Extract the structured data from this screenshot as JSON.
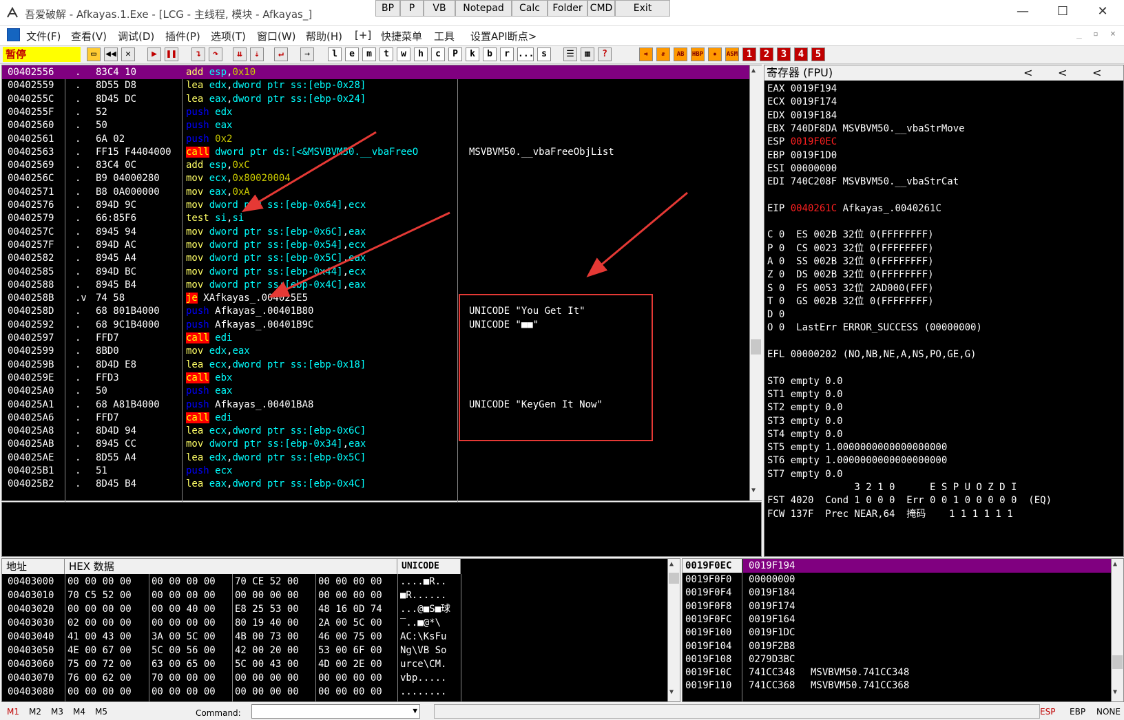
{
  "window": {
    "title": "吾爱破解 - Afkayas.1.Exe - [LCG - 主线程, 模块 - Afkayas_]",
    "top_buttons": [
      "BP",
      "P",
      "VB",
      "Notepad",
      "Calc",
      "Folder",
      "CMD",
      "Exit"
    ],
    "controls": [
      "—",
      "☐",
      "✕"
    ]
  },
  "menu": [
    "文件(F)",
    "查看(V)",
    "调试(D)",
    "插件(P)",
    "选项(T)",
    "窗口(W)",
    "帮助(H)",
    "[+]",
    "快捷菜单",
    "工具",
    "设置API断点>"
  ],
  "toolbar": {
    "status": "暂停",
    "letters": [
      "l",
      "e",
      "m",
      "t",
      "w",
      "h",
      "c",
      "P",
      "k",
      "b",
      "r",
      "...",
      "s"
    ],
    "numbers": [
      "1",
      "2",
      "3",
      "4",
      "5"
    ]
  },
  "cpu": {
    "rows": [
      {
        "addr": "00402556",
        "mark": ".",
        "hex": "83C4 10",
        "asm": [
          [
            "mn",
            "add "
          ],
          [
            "reg",
            "esp"
          ],
          [
            "txt",
            ","
          ],
          [
            "imm",
            "0x10"
          ]
        ],
        "comment": "",
        "selected": true
      },
      {
        "addr": "00402559",
        "mark": ".",
        "hex": "8D55 D8",
        "asm": [
          [
            "mn",
            "lea "
          ],
          [
            "reg",
            "edx"
          ],
          [
            "txt",
            ","
          ],
          [
            "reg",
            "dword ptr ss:[ebp-0x28]"
          ]
        ],
        "comment": ""
      },
      {
        "addr": "0040255C",
        "mark": ".",
        "hex": "8D45 DC",
        "asm": [
          [
            "mn",
            "lea "
          ],
          [
            "reg",
            "eax"
          ],
          [
            "txt",
            ","
          ],
          [
            "reg",
            "dword ptr ss:[ebp-0x24]"
          ]
        ],
        "comment": ""
      },
      {
        "addr": "0040255F",
        "mark": ".",
        "hex": "52",
        "asm": [
          [
            "push",
            "push "
          ],
          [
            "reg",
            "edx"
          ]
        ],
        "comment": ""
      },
      {
        "addr": "00402560",
        "mark": ".",
        "hex": "50",
        "asm": [
          [
            "push",
            "push "
          ],
          [
            "reg",
            "eax"
          ]
        ],
        "comment": ""
      },
      {
        "addr": "00402561",
        "mark": ".",
        "hex": "6A 02",
        "asm": [
          [
            "push",
            "push "
          ],
          [
            "imm",
            "0x2"
          ]
        ],
        "comment": ""
      },
      {
        "addr": "00402563",
        "mark": ".",
        "hex": "FF15 F4404000",
        "asm": [
          [
            "call",
            "call"
          ],
          [
            "txt",
            " "
          ],
          [
            "reg",
            "dword ptr ds:[<&MSVBVM50.__vbaFreeO"
          ]
        ],
        "comment": "MSVBVM50.__vbaFreeObjList"
      },
      {
        "addr": "00402569",
        "mark": ".",
        "hex": "83C4 0C",
        "asm": [
          [
            "mn",
            "add "
          ],
          [
            "reg",
            "esp"
          ],
          [
            "txt",
            ","
          ],
          [
            "imm",
            "0xC"
          ]
        ],
        "comment": ""
      },
      {
        "addr": "0040256C",
        "mark": ".",
        "hex": "B9 04000280",
        "asm": [
          [
            "mn",
            "mov "
          ],
          [
            "reg",
            "ecx"
          ],
          [
            "txt",
            ","
          ],
          [
            "imm",
            "0x80020004"
          ]
        ],
        "comment": ""
      },
      {
        "addr": "00402571",
        "mark": ".",
        "hex": "B8 0A000000",
        "asm": [
          [
            "mn",
            "mov "
          ],
          [
            "reg",
            "eax"
          ],
          [
            "txt",
            ","
          ],
          [
            "imm",
            "0xA"
          ]
        ],
        "comment": ""
      },
      {
        "addr": "00402576",
        "mark": ".",
        "hex": "894D 9C",
        "asm": [
          [
            "mn",
            "mov "
          ],
          [
            "reg",
            "dword ptr ss:[ebp-0x64]"
          ],
          [
            "txt",
            ","
          ],
          [
            "reg",
            "ecx"
          ]
        ],
        "comment": ""
      },
      {
        "addr": "00402579",
        "mark": ".",
        "hex": "66:85F6",
        "asm": [
          [
            "mn",
            "test "
          ],
          [
            "reg",
            "si"
          ],
          [
            "txt",
            ","
          ],
          [
            "reg",
            "si"
          ]
        ],
        "comment": ""
      },
      {
        "addr": "0040257C",
        "mark": ".",
        "hex": "8945 94",
        "asm": [
          [
            "mn",
            "mov "
          ],
          [
            "reg",
            "dword ptr ss:[ebp-0x6C]"
          ],
          [
            "txt",
            ","
          ],
          [
            "reg",
            "eax"
          ]
        ],
        "comment": ""
      },
      {
        "addr": "0040257F",
        "mark": ".",
        "hex": "894D AC",
        "asm": [
          [
            "mn",
            "mov "
          ],
          [
            "reg",
            "dword ptr ss:[ebp-0x54]"
          ],
          [
            "txt",
            ","
          ],
          [
            "reg",
            "ecx"
          ]
        ],
        "comment": ""
      },
      {
        "addr": "00402582",
        "mark": ".",
        "hex": "8945 A4",
        "asm": [
          [
            "mn",
            "mov "
          ],
          [
            "reg",
            "dword ptr ss:[ebp-0x5C]"
          ],
          [
            "txt",
            ","
          ],
          [
            "reg",
            "eax"
          ]
        ],
        "comment": ""
      },
      {
        "addr": "00402585",
        "mark": ".",
        "hex": "894D BC",
        "asm": [
          [
            "mn",
            "mov "
          ],
          [
            "reg",
            "dword ptr ss:[ebp-0x44]"
          ],
          [
            "txt",
            ","
          ],
          [
            "reg",
            "ecx"
          ]
        ],
        "comment": ""
      },
      {
        "addr": "00402588",
        "mark": ".",
        "hex": "8945 B4",
        "asm": [
          [
            "mn",
            "mov "
          ],
          [
            "reg",
            "dword ptr ss:[ebp-0x4C]"
          ],
          [
            "txt",
            ","
          ],
          [
            "reg",
            "eax"
          ]
        ],
        "comment": ""
      },
      {
        "addr": "0040258B",
        "mark": ".v",
        "hex": "74 58",
        "asm": [
          [
            "je",
            "je"
          ],
          [
            "txt",
            " XAfkayas_.004025E5"
          ]
        ],
        "comment": ""
      },
      {
        "addr": "0040258D",
        "mark": ".",
        "hex": "68 801B4000",
        "asm": [
          [
            "push",
            "push "
          ],
          [
            "txt",
            "Afkayas_.00401B80"
          ]
        ],
        "comment": "UNICODE \"You Get It\""
      },
      {
        "addr": "00402592",
        "mark": ".",
        "hex": "68 9C1B4000",
        "asm": [
          [
            "push",
            "push "
          ],
          [
            "txt",
            "Afkayas_.00401B9C"
          ]
        ],
        "comment": "UNICODE \"■■\""
      },
      {
        "addr": "00402597",
        "mark": ".",
        "hex": "FFD7",
        "asm": [
          [
            "call",
            "call"
          ],
          [
            "txt",
            " "
          ],
          [
            "reg",
            "edi"
          ]
        ],
        "comment": ""
      },
      {
        "addr": "00402599",
        "mark": ".",
        "hex": "8BD0",
        "asm": [
          [
            "mn",
            "mov "
          ],
          [
            "reg",
            "edx"
          ],
          [
            "txt",
            ","
          ],
          [
            "reg",
            "eax"
          ]
        ],
        "comment": ""
      },
      {
        "addr": "0040259B",
        "mark": ".",
        "hex": "8D4D E8",
        "asm": [
          [
            "mn",
            "lea "
          ],
          [
            "reg",
            "ecx"
          ],
          [
            "txt",
            ","
          ],
          [
            "reg",
            "dword ptr ss:[ebp-0x18]"
          ]
        ],
        "comment": ""
      },
      {
        "addr": "0040259E",
        "mark": ".",
        "hex": "FFD3",
        "asm": [
          [
            "call",
            "call"
          ],
          [
            "txt",
            " "
          ],
          [
            "reg",
            "ebx"
          ]
        ],
        "comment": ""
      },
      {
        "addr": "004025A0",
        "mark": ".",
        "hex": "50",
        "asm": [
          [
            "push",
            "push "
          ],
          [
            "reg",
            "eax"
          ]
        ],
        "comment": ""
      },
      {
        "addr": "004025A1",
        "mark": ".",
        "hex": "68 A81B4000",
        "asm": [
          [
            "push",
            "push "
          ],
          [
            "txt",
            "Afkayas_.00401BA8"
          ]
        ],
        "comment": "UNICODE \"KeyGen It Now\""
      },
      {
        "addr": "004025A6",
        "mark": ".",
        "hex": "FFD7",
        "asm": [
          [
            "call",
            "call"
          ],
          [
            "txt",
            " "
          ],
          [
            "reg",
            "edi"
          ]
        ],
        "comment": ""
      },
      {
        "addr": "004025A8",
        "mark": ".",
        "hex": "8D4D 94",
        "asm": [
          [
            "mn",
            "lea "
          ],
          [
            "reg",
            "ecx"
          ],
          [
            "txt",
            ","
          ],
          [
            "reg",
            "dword ptr ss:[ebp-0x6C]"
          ]
        ],
        "comment": ""
      },
      {
        "addr": "004025AB",
        "mark": ".",
        "hex": "8945 CC",
        "asm": [
          [
            "mn",
            "mov "
          ],
          [
            "reg",
            "dword ptr ss:[ebp-0x34]"
          ],
          [
            "txt",
            ","
          ],
          [
            "reg",
            "eax"
          ]
        ],
        "comment": ""
      },
      {
        "addr": "004025AE",
        "mark": ".",
        "hex": "8D55 A4",
        "asm": [
          [
            "mn",
            "lea "
          ],
          [
            "reg",
            "edx"
          ],
          [
            "txt",
            ","
          ],
          [
            "reg",
            "dword ptr ss:[ebp-0x5C]"
          ]
        ],
        "comment": ""
      },
      {
        "addr": "004025B1",
        "mark": ".",
        "hex": "51",
        "asm": [
          [
            "push",
            "push "
          ],
          [
            "reg",
            "ecx"
          ]
        ],
        "comment": ""
      },
      {
        "addr": "004025B2",
        "mark": ".",
        "hex": "8D45 B4",
        "asm": [
          [
            "mn",
            "lea "
          ],
          [
            "reg",
            "eax"
          ],
          [
            "txt",
            ","
          ],
          [
            "reg",
            "dword ptr ss:[ebp-0x4C]"
          ]
        ],
        "comment": ""
      }
    ]
  },
  "registers": {
    "header": "寄存器 (FPU)",
    "nav": [
      "<",
      "<",
      "<"
    ],
    "lines": [
      [
        [
          "w",
          "EAX 0019F194"
        ]
      ],
      [
        [
          "w",
          "ECX 0019F174"
        ]
      ],
      [
        [
          "w",
          "EDX 0019F184"
        ]
      ],
      [
        [
          "w",
          "EBX 740DF8DA MSVBVM50.__vbaStrMove"
        ]
      ],
      [
        [
          "w",
          "ESP "
        ],
        [
          "r",
          "0019F0EC"
        ]
      ],
      [
        [
          "w",
          "EBP 0019F1D0"
        ]
      ],
      [
        [
          "w",
          "ESI 00000000"
        ]
      ],
      [
        [
          "w",
          "EDI 740C208F MSVBVM50.__vbaStrCat"
        ]
      ],
      [
        [
          "w",
          ""
        ]
      ],
      [
        [
          "w",
          "EIP "
        ],
        [
          "r",
          "0040261C"
        ],
        [
          "w",
          " Afkayas_.0040261C"
        ]
      ],
      [
        [
          "w",
          ""
        ]
      ],
      [
        [
          "w",
          "C 0  ES 002B 32位 0(FFFFFFFF)"
        ]
      ],
      [
        [
          "w",
          "P 0  CS 0023 32位 0(FFFFFFFF)"
        ]
      ],
      [
        [
          "w",
          "A 0  SS 002B 32位 0(FFFFFFFF)"
        ]
      ],
      [
        [
          "w",
          "Z 0  DS 002B 32位 0(FFFFFFFF)"
        ]
      ],
      [
        [
          "w",
          "S 0  FS 0053 32位 2AD000(FFF)"
        ]
      ],
      [
        [
          "w",
          "T 0  GS 002B 32位 0(FFFFFFFF)"
        ]
      ],
      [
        [
          "w",
          "D 0"
        ]
      ],
      [
        [
          "w",
          "O 0  LastErr ERROR_SUCCESS (00000000)"
        ]
      ],
      [
        [
          "w",
          ""
        ]
      ],
      [
        [
          "w",
          "EFL 00000202 (NO,NB,NE,A,NS,PO,GE,G)"
        ]
      ],
      [
        [
          "w",
          ""
        ]
      ],
      [
        [
          "w",
          "ST0 empty 0.0"
        ]
      ],
      [
        [
          "w",
          "ST1 empty 0.0"
        ]
      ],
      [
        [
          "w",
          "ST2 empty 0.0"
        ]
      ],
      [
        [
          "w",
          "ST3 empty 0.0"
        ]
      ],
      [
        [
          "w",
          "ST4 empty 0.0"
        ]
      ],
      [
        [
          "w",
          "ST5 empty 1.0000000000000000000"
        ]
      ],
      [
        [
          "w",
          "ST6 empty 1.0000000000000000000"
        ]
      ],
      [
        [
          "w",
          "ST7 empty 0.0"
        ]
      ],
      [
        [
          "w",
          "               3 2 1 0      E S P U O Z D I"
        ]
      ],
      [
        [
          "w",
          "FST 4020  Cond 1 0 0 0  Err 0 0 1 0 0 0 0 0  (EQ)"
        ]
      ],
      [
        [
          "w",
          "FCW 137F  Prec NEAR,64  掩码    1 1 1 1 1 1"
        ]
      ]
    ]
  },
  "dump": {
    "headers": [
      "地址",
      "HEX 数据",
      "UNICODE"
    ],
    "rows": [
      {
        "addr": "00403000",
        "g": [
          "00 00 00 00",
          "00 00 00 00",
          "70 CE 52 00",
          "00 00 00 00"
        ],
        "u": "....■R.."
      },
      {
        "addr": "00403010",
        "g": [
          "70 C5 52 00",
          "00 00 00 00",
          "00 00 00 00",
          "00 00 00 00"
        ],
        "u": "■R......"
      },
      {
        "addr": "00403020",
        "g": [
          "00 00 00 00",
          "00 00 40 00",
          "E8 25 53 00",
          "48 16 0D 74"
        ],
        "u": "...@■S■球"
      },
      {
        "addr": "00403030",
        "g": [
          "02 00 00 00",
          "00 00 00 00",
          "80 19 40 00",
          "2A 00 5C 00"
        ],
        "u": "‾..■@*\\"
      },
      {
        "addr": "00403040",
        "g": [
          "41 00 43 00",
          "3A 00 5C 00",
          "4B 00 73 00",
          "46 00 75 00"
        ],
        "u": "AC:\\KsFu"
      },
      {
        "addr": "00403050",
        "g": [
          "4E 00 67 00",
          "5C 00 56 00",
          "42 00 20 00",
          "53 00 6F 00"
        ],
        "u": "Ng\\VB So"
      },
      {
        "addr": "00403060",
        "g": [
          "75 00 72 00",
          "63 00 65 00",
          "5C 00 43 00",
          "4D 00 2E 00"
        ],
        "u": "urce\\CM."
      },
      {
        "addr": "00403070",
        "g": [
          "76 00 62 00",
          "70 00 00 00",
          "00 00 00 00",
          "00 00 00 00"
        ],
        "u": "vbp....."
      },
      {
        "addr": "00403080",
        "g": [
          "00 00 00 00",
          "00 00 00 00",
          "00 00 00 00",
          "00 00 00 00"
        ],
        "u": "........"
      }
    ]
  },
  "stack": {
    "header_addr": "0019F0EC",
    "header_val": "0019F194",
    "rows": [
      {
        "addr": "0019F0F0",
        "val": "00000000",
        "c": ""
      },
      {
        "addr": "0019F0F4",
        "val": "0019F184",
        "c": ""
      },
      {
        "addr": "0019F0F8",
        "val": "0019F174",
        "c": ""
      },
      {
        "addr": "0019F0FC",
        "val": "0019F164",
        "c": ""
      },
      {
        "addr": "0019F100",
        "val": "0019F1DC",
        "c": ""
      },
      {
        "addr": "0019F104",
        "val": "0019F2B8",
        "c": ""
      },
      {
        "addr": "0019F108",
        "val": "0279D3BC",
        "c": ""
      },
      {
        "addr": "0019F10C",
        "val": "741CC348",
        "c": "MSVBVM50.741CC348"
      },
      {
        "addr": "0019F110",
        "val": "741CC368",
        "c": "MSVBVM50.741CC368"
      }
    ]
  },
  "statusbar": {
    "marks": [
      "M1",
      "M2",
      "M3",
      "M4",
      "M5"
    ],
    "command_label": "Command:",
    "right": [
      "ESP",
      "EBP",
      "NONE"
    ]
  },
  "colors": {
    "selection": "#800080",
    "call_bg": "#ff0000",
    "annotation": "#e53935"
  }
}
